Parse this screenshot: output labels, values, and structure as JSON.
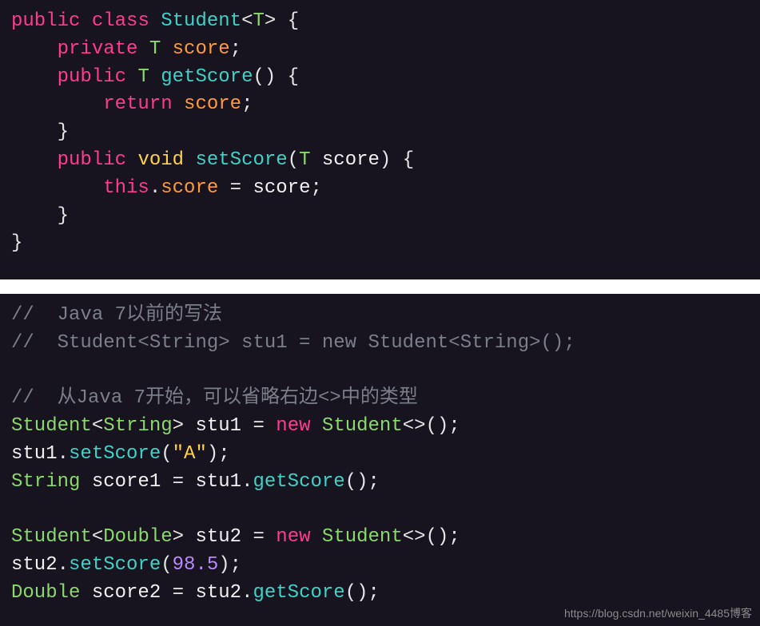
{
  "block1": {
    "l1": {
      "public": "public",
      "class": "class",
      "Student": "Student",
      "lt": "<",
      "T": "T",
      "gt": ">",
      "brace": " {"
    },
    "l2": {
      "indent": "    ",
      "private": "private",
      "T": "T",
      "score": "score",
      "semi": ";"
    },
    "l3": {
      "indent": "    ",
      "public": "public",
      "T": "T",
      "getScore": "getScore",
      "parens": "()",
      "brace": " {"
    },
    "l4": {
      "indent": "        ",
      "return": "return",
      "score": "score",
      "semi": ";"
    },
    "l5": {
      "indent": "    ",
      "brace": "}"
    },
    "l6": {
      "indent": "    ",
      "public": "public",
      "void": "void",
      "setScore": "setScore",
      "lp": "(",
      "T": "T",
      "param": "score",
      "rp": ")",
      "brace": " {"
    },
    "l7": {
      "indent": "        ",
      "this": "this",
      "dot": ".",
      "score": "score",
      "eq": " = ",
      "rhs": "score",
      "semi": ";"
    },
    "l8": {
      "indent": "    ",
      "brace": "}"
    },
    "l9": {
      "brace": "}"
    }
  },
  "block2": {
    "c1": "//  Java 7以前的写法",
    "c2": "//  Student<String> stu1 = new Student<String>();",
    "c3": "//  从Java 7开始，可以省略右边<>中的类型",
    "l1": {
      "Student": "Student",
      "lt": "<",
      "String": "String",
      "gt": ">",
      "stu1": " stu1 ",
      "eq": "= ",
      "new": "new",
      "sp": " ",
      "Student2": "Student",
      "diamond": "<>",
      "parens": "()",
      "semi": ";"
    },
    "l2": {
      "stu1": "stu1",
      "dot": ".",
      "setScore": "setScore",
      "lp": "(",
      "str": "\"A\"",
      "rp": ")",
      "semi": ";"
    },
    "l3": {
      "String": "String",
      "score1": " score1 ",
      "eq": "= ",
      "stu1": "stu1",
      "dot": ".",
      "getScore": "getScore",
      "parens": "()",
      "semi": ";"
    },
    "l4": {
      "Student": "Student",
      "lt": "<",
      "Double": "Double",
      "gt": ">",
      "stu2": " stu2 ",
      "eq": "= ",
      "new": "new",
      "sp": " ",
      "Student2": "Student",
      "diamond": "<>",
      "parens": "()",
      "semi": ";"
    },
    "l5": {
      "stu2": "stu2",
      "dot": ".",
      "setScore": "setScore",
      "lp": "(",
      "num": "98.5",
      "rp": ")",
      "semi": ";"
    },
    "l6": {
      "Double": "Double",
      "score2": " score2 ",
      "eq": "= ",
      "stu2": "stu2",
      "dot": ".",
      "getScore": "getScore",
      "parens": "()",
      "semi": ";"
    }
  },
  "watermark": "https://blog.csdn.net/weixin_4485博客"
}
